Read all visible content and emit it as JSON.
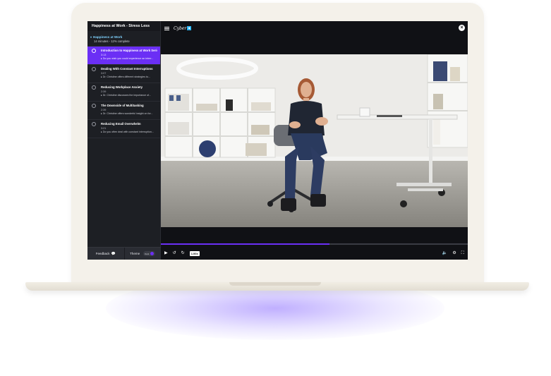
{
  "course": {
    "title": "Happiness at Work - Stress Less",
    "module": {
      "title": "Happiness at Work",
      "subtitle": "14 minutes - 12% complete"
    },
    "lessons": [
      {
        "title": "Introduction to Happiness at Work Series",
        "duration": "3:13",
        "desc": "Do you wish you could experience an interr...",
        "active": true
      },
      {
        "title": "Dealing With Constant Interruptions",
        "duration": "3:07",
        "desc": "Dr. Christine offers different strategies to...",
        "active": false
      },
      {
        "title": "Reducing Workplace Anxiety",
        "duration": "2:39",
        "desc": "Dr. Christine discusses the importance of...",
        "active": false
      },
      {
        "title": "The Downside of Multitasking",
        "duration": "2:39",
        "desc": "Dr. Christine offers wonderful insight on for...",
        "active": false
      },
      {
        "title": "Reducing Email Overwhelm",
        "duration": "3:21",
        "desc": "Do you often deal with constant interruption...",
        "active": false
      }
    ]
  },
  "footer": {
    "feedback_label": "Feedback",
    "theme_label": "Theme",
    "theme_value": "Dark"
  },
  "player": {
    "logo_text": "Cyber",
    "progress": 0.55,
    "speed": "1.00x",
    "icons": {
      "menu": "hamburger-icon",
      "close": "close-icon",
      "play": "play-icon",
      "rewind": "rewind-icon",
      "forward": "forward-icon",
      "volume": "volume-icon",
      "settings": "gear-icon",
      "fullscreen": "fullscreen-icon",
      "feedback": "chat-icon"
    }
  },
  "colors": {
    "accent": "#6b2ff5",
    "sidebar": "#1d1f24",
    "player_bg": "#101115",
    "module_title": "#7fd3ff"
  }
}
